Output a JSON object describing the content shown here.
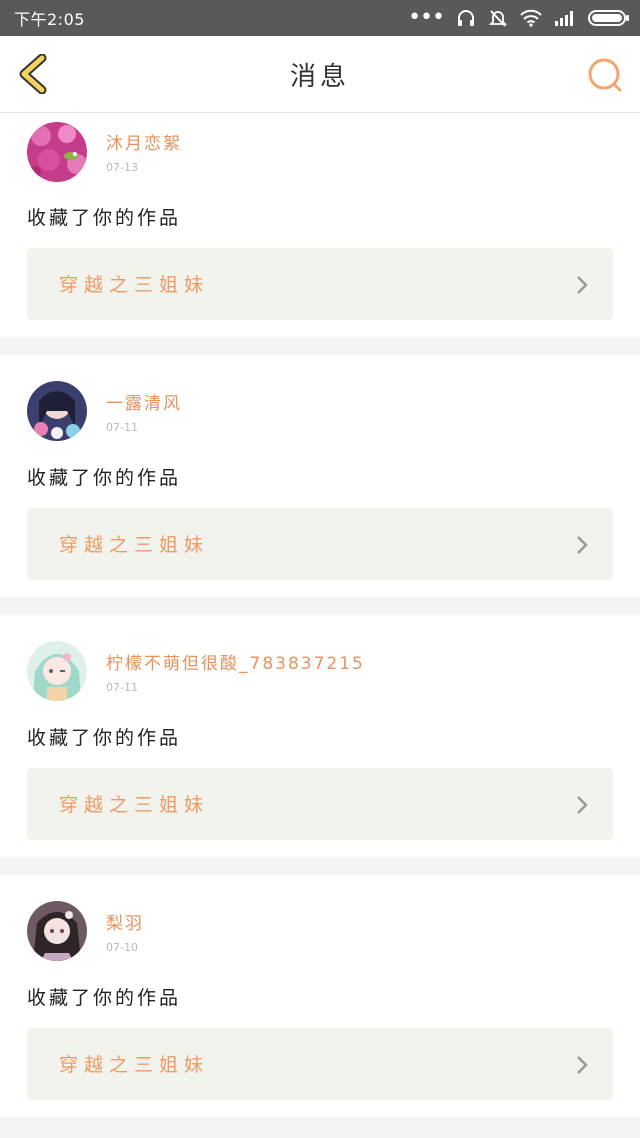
{
  "status_bar": {
    "time": "下午2:05",
    "icons": [
      "more-dots-icon",
      "headset-icon",
      "mute-icon",
      "wifi-icon",
      "signal-icon",
      "battery-icon"
    ]
  },
  "header": {
    "title": "消息",
    "back_icon": "chevron-left-icon",
    "search_icon": "search-icon",
    "accent_color": "#f0a66d"
  },
  "messages": [
    {
      "username": "沐月恋絮",
      "date": "07-13",
      "action": "收藏了你的作品",
      "work_title": "穿越之三姐妹",
      "avatar": "avatar-flowers"
    },
    {
      "username": "一露清风",
      "date": "07-11",
      "action": "收藏了你的作品",
      "work_title": "穿越之三姐妹",
      "avatar": "avatar-anime-girl-flowers"
    },
    {
      "username": "柠檬不萌但很酸_783837215",
      "date": "07-11",
      "action": "收藏了你的作品",
      "work_title": "穿越之三姐妹",
      "avatar": "avatar-anime-girl-green"
    },
    {
      "username": "梨羽",
      "date": "07-10",
      "action": "收藏了你的作品",
      "work_title": "穿越之三姐妹",
      "avatar": "avatar-anime-girl-dark"
    }
  ]
}
